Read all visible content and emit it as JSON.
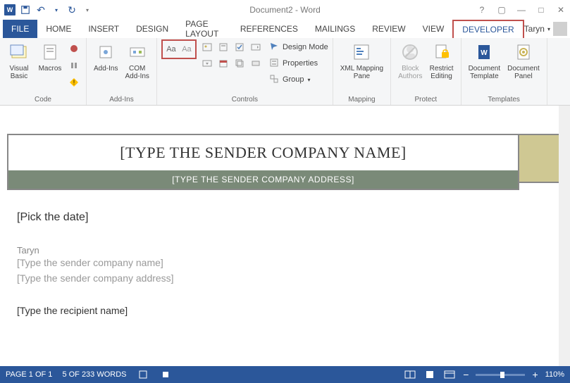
{
  "titlebar": {
    "title": "Document2 - Word"
  },
  "tabs": {
    "file": "FILE",
    "home": "HOME",
    "insert": "INSERT",
    "design": "DESIGN",
    "page_layout": "PAGE LAYOUT",
    "references": "REFERENCES",
    "mailings": "MAILINGS",
    "review": "REVIEW",
    "view": "VIEW",
    "developer": "DEVELOPER"
  },
  "user": {
    "name": "Taryn"
  },
  "ribbon": {
    "code": {
      "visual_basic": "Visual\nBasic",
      "macros": "Macros",
      "label": "Code"
    },
    "addins": {
      "addins": "Add-Ins",
      "com": "COM\nAdd-Ins",
      "label": "Add-Ins"
    },
    "controls": {
      "design_mode": "Design Mode",
      "properties": "Properties",
      "group": "Group",
      "label": "Controls"
    },
    "mapping": {
      "xml": "XML Mapping\nPane",
      "label": "Mapping"
    },
    "protect": {
      "block": "Block\nAuthors",
      "restrict": "Restrict\nEditing",
      "label": "Protect"
    },
    "templates": {
      "template": "Document\nTemplate",
      "panel": "Document\nPanel",
      "label": "Templates"
    }
  },
  "document": {
    "company_name": "[TYPE THE SENDER COMPANY NAME]",
    "company_address": "[TYPE THE SENDER COMPANY ADDRESS]",
    "date": "[Pick the date]",
    "sender_name": "Taryn",
    "sender_company": "[Type the sender company name]",
    "sender_address": "[Type the sender company address]",
    "recipient": "[Type the recipient name]"
  },
  "statusbar": {
    "page": "PAGE 1 OF 1",
    "words": "5 OF 233 WORDS",
    "zoom": "110%",
    "minus": "−",
    "plus": "+"
  }
}
